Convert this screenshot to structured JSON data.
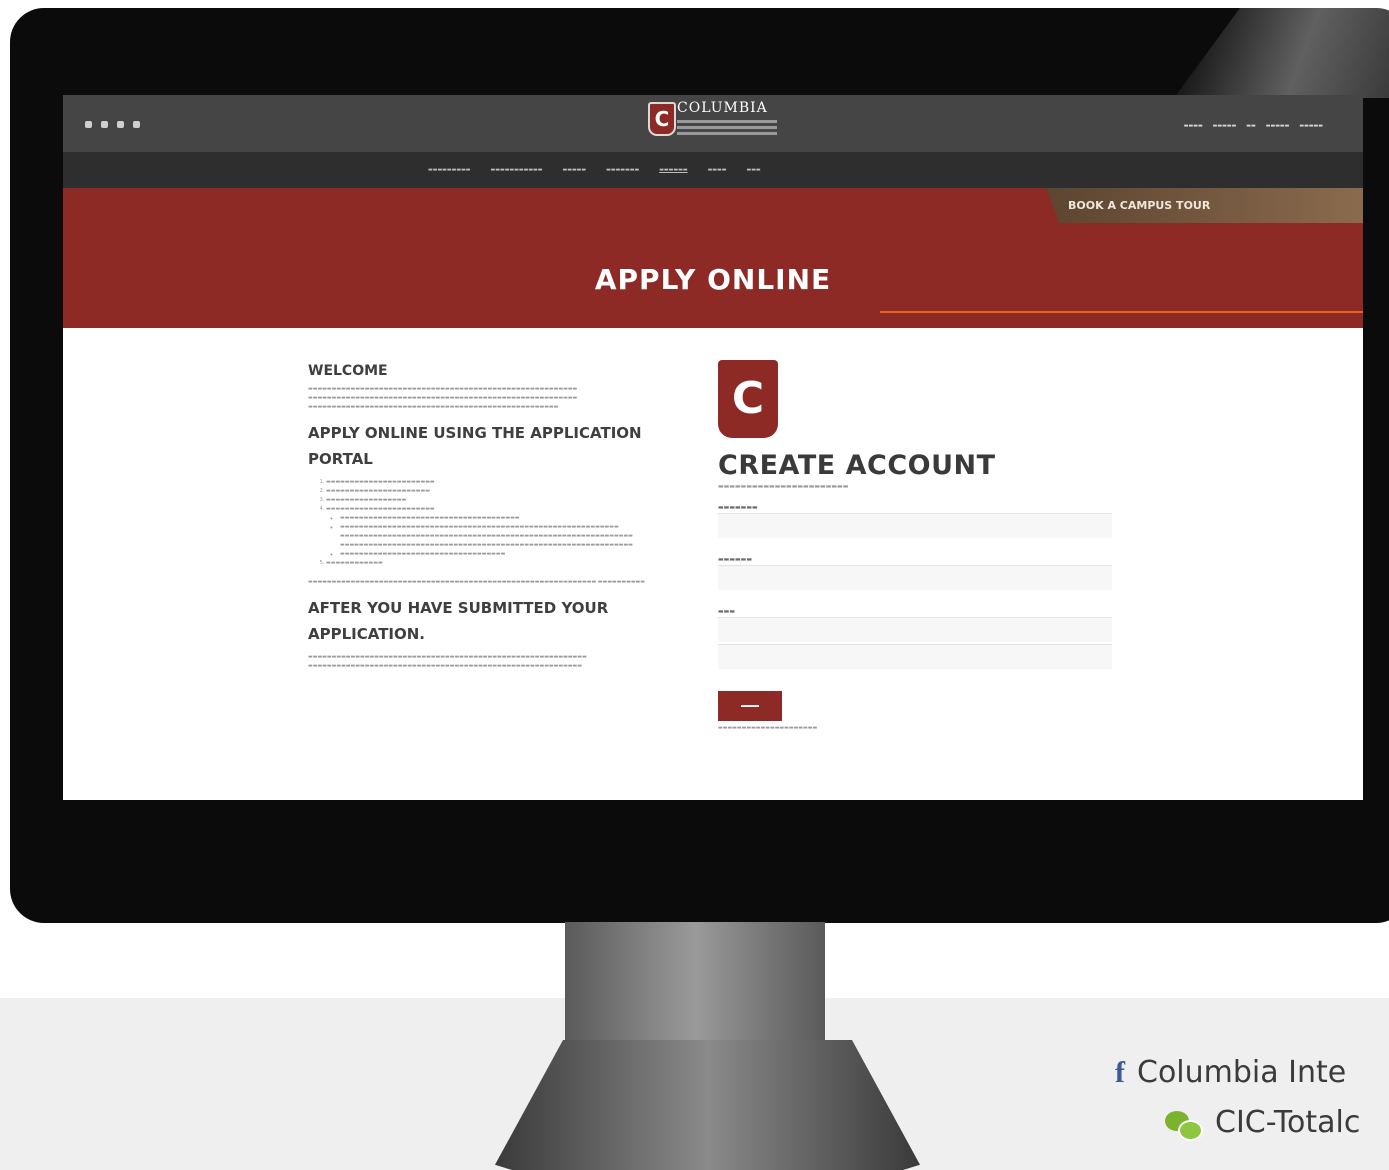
{
  "site": {
    "logo_text": "COLUMBIA",
    "logo_mark": "C",
    "social_icons": [
      "instagram-icon",
      "facebook-icon",
      "youtube-icon",
      "wechat-icon"
    ],
    "tour_button": "BOOK A CAMPUS TOUR",
    "hero_title": "APPLY ONLINE"
  },
  "welcome": {
    "heading": "WELCOME"
  },
  "apply_section": {
    "heading": "APPLY ONLINE USING THE APPLICATION PORTAL"
  },
  "after_section": {
    "heading": "AFTER YOU HAVE SUBMITTED YOUR APPLICATION."
  },
  "form": {
    "badge_letter": "C",
    "title": "CREATE ACCOUNT"
  },
  "footer": {
    "facebook": "Columbia Inte",
    "wechat": "CIC-Totalc"
  },
  "colors": {
    "brand_red": "#8e2a25",
    "tour_brown": "#7a5c40",
    "accent_orange": "#e8641a",
    "topbar": "#454545"
  }
}
